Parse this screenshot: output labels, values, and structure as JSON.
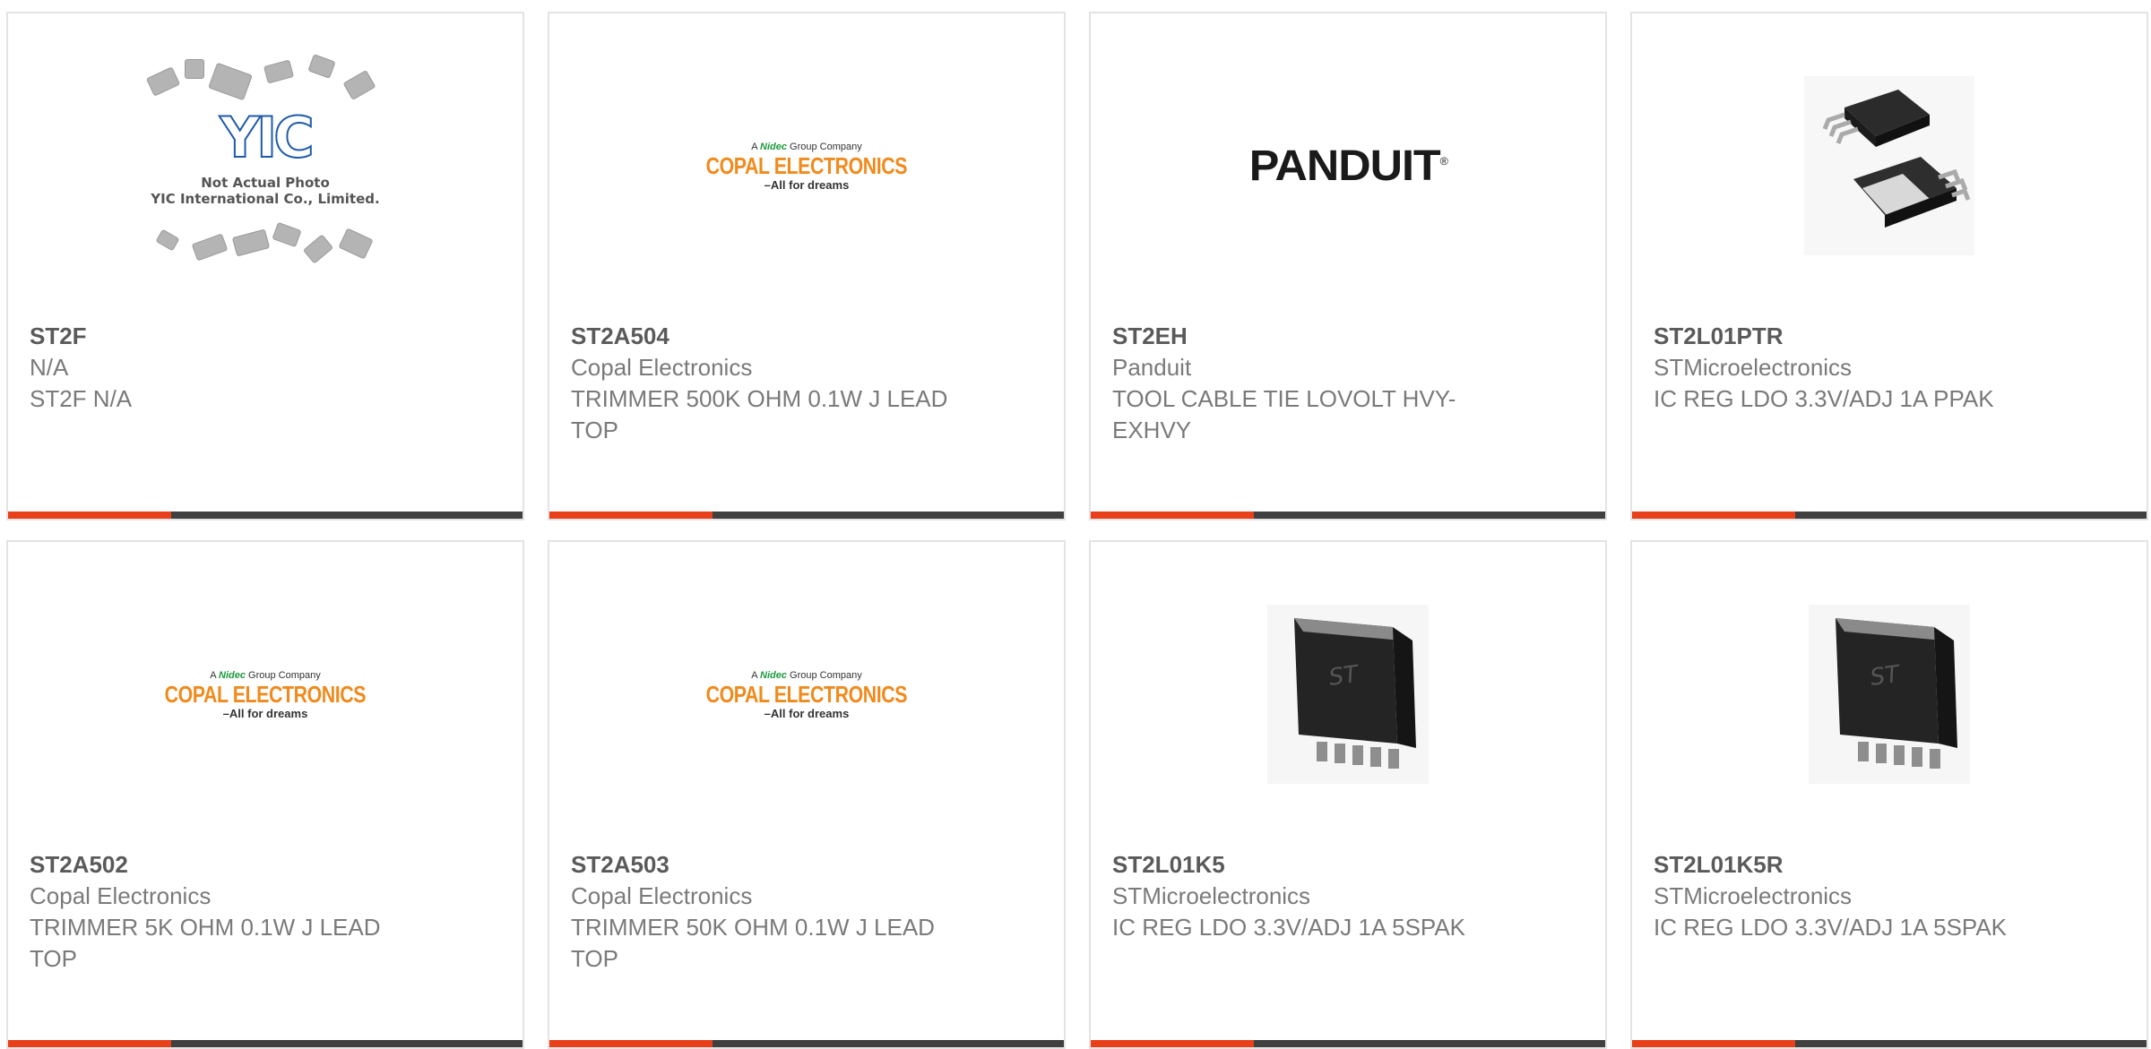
{
  "products": [
    {
      "part_number": "ST2F",
      "manufacturer": "N/A",
      "description": "ST2F N/A",
      "image": "yic-placeholder"
    },
    {
      "part_number": "ST2A504",
      "manufacturer": "Copal Electronics",
      "description": "TRIMMER 500K OHM 0.1W J LEAD TOP",
      "image": "copal-logo"
    },
    {
      "part_number": "ST2EH",
      "manufacturer": "Panduit",
      "description": "TOOL CABLE TIE LOVOLT HVY-EXHVY",
      "image": "panduit-logo"
    },
    {
      "part_number": "ST2L01PTR",
      "manufacturer": "STMicroelectronics",
      "description": "IC REG LDO 3.3V/ADJ 1A PPAK",
      "image": "ppak-package"
    },
    {
      "part_number": "ST2A502",
      "manufacturer": "Copal Electronics",
      "description": "TRIMMER 5K OHM 0.1W J LEAD TOP",
      "image": "copal-logo"
    },
    {
      "part_number": "ST2A503",
      "manufacturer": "Copal Electronics",
      "description": "TRIMMER 50K OHM 0.1W J LEAD TOP",
      "image": "copal-logo"
    },
    {
      "part_number": "ST2L01K5",
      "manufacturer": "STMicroelectronics",
      "description": "IC REG LDO 3.3V/ADJ 1A 5SPAK",
      "image": "spak-package"
    },
    {
      "part_number": "ST2L01K5R",
      "manufacturer": "STMicroelectronics",
      "description": "IC REG LDO 3.3V/ADJ 1A 5SPAK",
      "image": "spak-package"
    }
  ],
  "placeholder": {
    "logo_text": "YIC",
    "line1": "Not Actual Photo",
    "line2": "YIC International Co., Limited."
  },
  "copal_logo": {
    "top_prefix": "A",
    "brand": "Nidec",
    "top_suffix": "Group Company",
    "main": "COPAL ELECTRONICS",
    "tagline": "–All for dreams"
  },
  "panduit_logo": {
    "text": "PANDUIT"
  },
  "colors": {
    "accent": "#e8401a",
    "bar": "#404040",
    "border": "#e3e3e3",
    "copal_orange": "#f08a1c",
    "nidec_green": "#1c9b3c",
    "yic_blue": "#1f5aa8"
  }
}
